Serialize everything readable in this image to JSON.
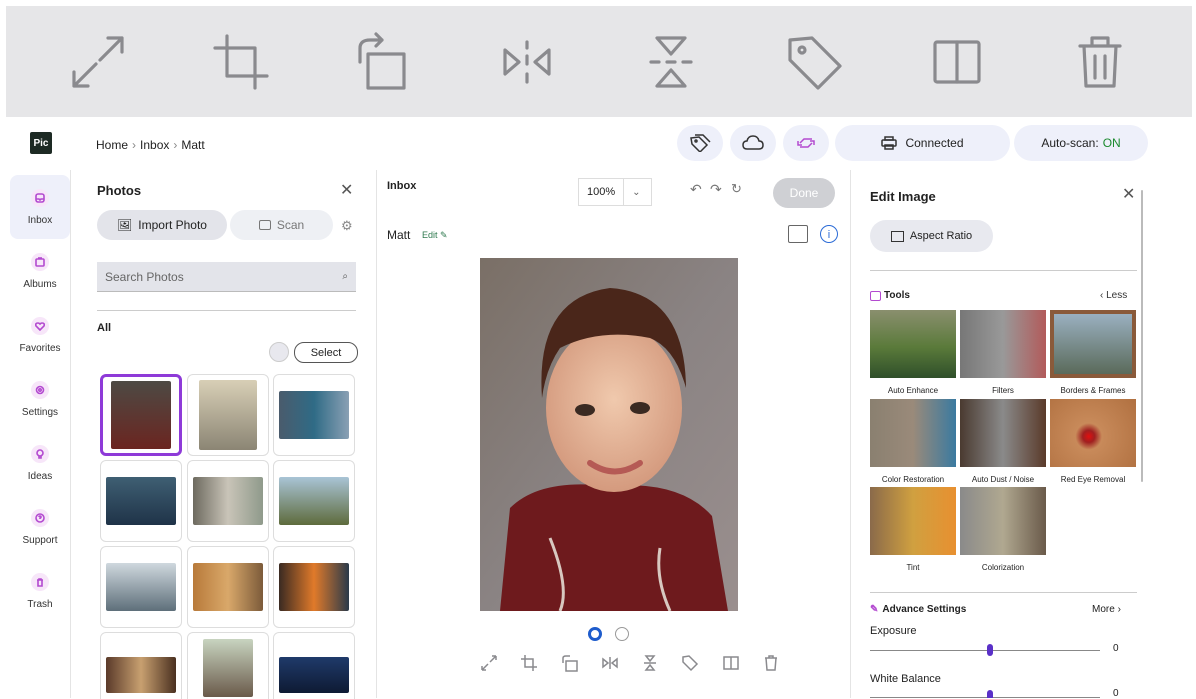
{
  "toolbar_big": {
    "icons": [
      "expand-icon",
      "crop-icon",
      "rotate-icon",
      "flip-horizontal-icon",
      "flip-vertical-icon",
      "tag-icon",
      "compare-icon",
      "trash-icon"
    ]
  },
  "header": {
    "logo": "Pic",
    "breadcrumb": [
      "Home",
      "Inbox",
      "Matt"
    ],
    "printer_label": "Connected",
    "autoscan_label": "Auto-scan:",
    "autoscan_value": "ON"
  },
  "rail": {
    "items": [
      {
        "label": "Inbox",
        "icon": "inbox-icon"
      },
      {
        "label": "Albums",
        "icon": "albums-icon"
      },
      {
        "label": "Favorites",
        "icon": "heart-icon"
      },
      {
        "label": "Settings",
        "icon": "gear-icon"
      },
      {
        "label": "Ideas",
        "icon": "lightbulb-icon"
      },
      {
        "label": "Support",
        "icon": "question-icon"
      },
      {
        "label": "Trash",
        "icon": "trash-icon"
      }
    ]
  },
  "photos": {
    "title": "Photos",
    "import_label": "Import Photo",
    "scan_label": "Scan",
    "search_placeholder": "Search Photos",
    "section": "All",
    "select_label": "Select"
  },
  "center": {
    "title": "Inbox",
    "zoom": "100%",
    "done_label": "Done",
    "photo_name": "Matt",
    "edit_link": "Edit"
  },
  "edit_panel": {
    "title": "Edit Image",
    "aspect_label": "Aspect Ratio",
    "tools_title": "Tools",
    "less_label": "Less",
    "tools": [
      {
        "label": "Auto Enhance"
      },
      {
        "label": "Filters"
      },
      {
        "label": "Borders & Frames"
      },
      {
        "label": "Color Restoration"
      },
      {
        "label": "Auto Dust / Noise"
      },
      {
        "label": "Red Eye Removal"
      },
      {
        "label": "Tint"
      },
      {
        "label": "Colorization"
      }
    ],
    "advance_title": "Advance Settings",
    "more_label": "More",
    "sliders": [
      {
        "label": "Exposure",
        "value": "0"
      },
      {
        "label": "White Balance",
        "value": "0"
      }
    ]
  }
}
